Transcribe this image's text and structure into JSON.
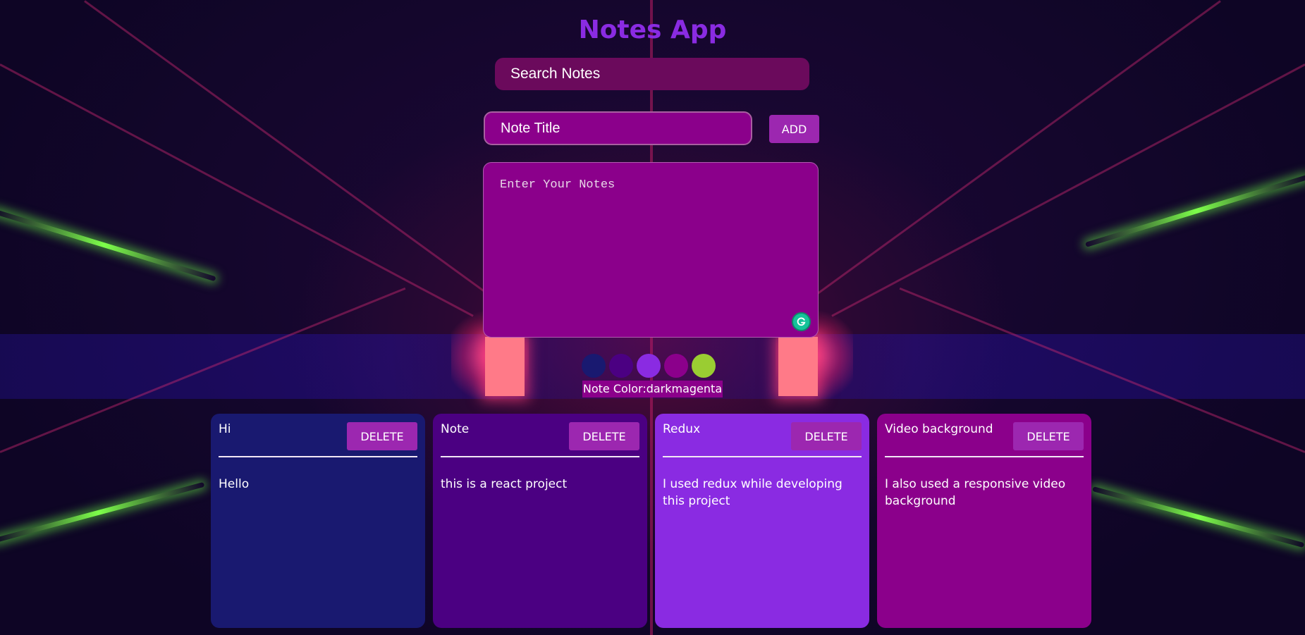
{
  "app": {
    "title": "Notes App"
  },
  "search": {
    "placeholder": "Search Notes"
  },
  "composer": {
    "title_placeholder": "Note Title",
    "add_label": "ADD",
    "notes_placeholder": "Enter Your Notes",
    "color_label": "Note Color:darkmagenta",
    "grammarly_icon": "grammarly-icon"
  },
  "colors": [
    "#191970",
    "#4b0082",
    "#8a2be2",
    "#8b008b",
    "#9acd32"
  ],
  "notes": [
    {
      "title": "Hi",
      "body": "Hello",
      "color": "#191970",
      "delete_label": "DELETE"
    },
    {
      "title": "Note",
      "body": "this is a react project",
      "color": "#4b0082",
      "delete_label": "DELETE"
    },
    {
      "title": "Redux",
      "body": "I used redux while developing this project",
      "color": "#8a2be2",
      "delete_label": "DELETE"
    },
    {
      "title": "Video background",
      "body": "I also used a responsive video background",
      "color": "#8b008b",
      "delete_label": "DELETE"
    }
  ]
}
